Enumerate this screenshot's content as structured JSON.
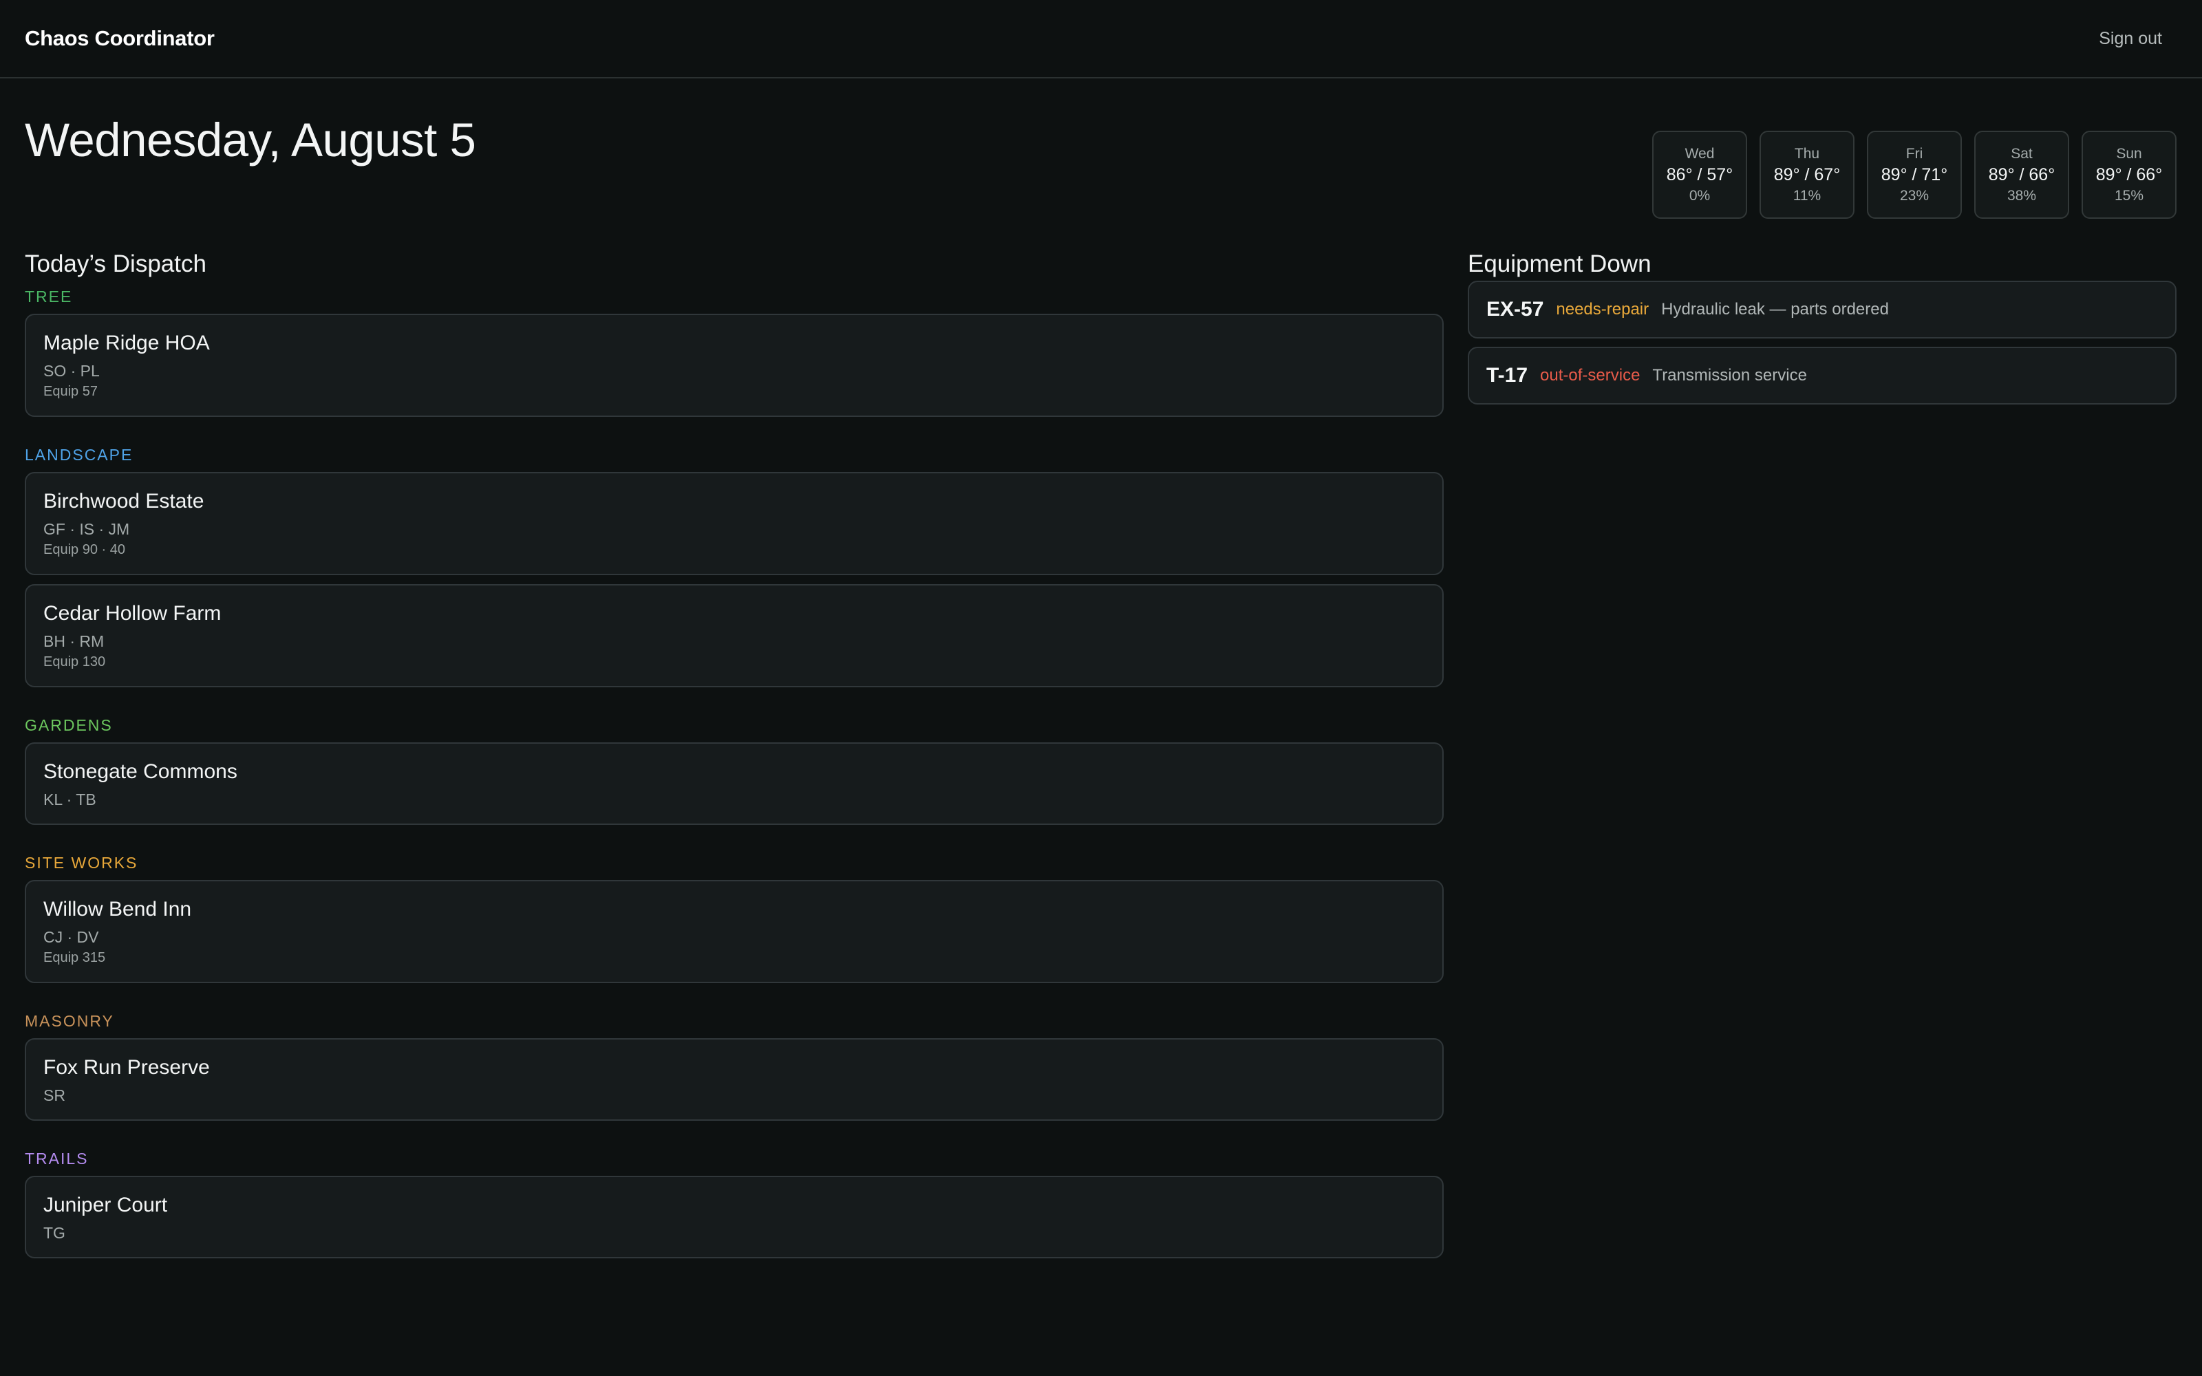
{
  "app": {
    "title": "Chaos Coordinator",
    "signout_label": "Sign out"
  },
  "page": {
    "date_title": "Wednesday, August 5"
  },
  "forecast": [
    {
      "day": "Wed",
      "temp": "86° / 57°",
      "rain": "0%"
    },
    {
      "day": "Thu",
      "temp": "89° / 67°",
      "rain": "11%"
    },
    {
      "day": "Fri",
      "temp": "89° / 71°",
      "rain": "23%"
    },
    {
      "day": "Sat",
      "temp": "89° / 66°",
      "rain": "38%"
    },
    {
      "day": "Sun",
      "temp": "89° / 66°",
      "rain": "15%"
    }
  ],
  "dispatch": {
    "title": "Today’s Dispatch",
    "groups": [
      {
        "label": "Tree",
        "color": "#4bb865",
        "jobs": [
          {
            "name": "Maple Ridge HOA",
            "crew": "SO · PL",
            "equip": "Equip 57"
          }
        ]
      },
      {
        "label": "Landscape",
        "color": "#4fa3e8",
        "jobs": [
          {
            "name": "Birchwood Estate",
            "crew": "GF · IS · JM",
            "equip": "Equip 90 · 40"
          },
          {
            "name": "Cedar Hollow Farm",
            "crew": "BH · RM",
            "equip": "Equip 130"
          }
        ]
      },
      {
        "label": "Gardens",
        "color": "#6cc75e",
        "jobs": [
          {
            "name": "Stonegate Commons",
            "crew": "KL · TB"
          }
        ]
      },
      {
        "label": "Site Works",
        "color": "#e8a83a",
        "jobs": [
          {
            "name": "Willow Bend Inn",
            "crew": "CJ · DV",
            "equip": "Equip 315"
          }
        ]
      },
      {
        "label": "Masonry",
        "color": "#c8925a",
        "jobs": [
          {
            "name": "Fox Run Preserve",
            "crew": "SR"
          }
        ]
      },
      {
        "label": "Trails",
        "color": "#b48cf0",
        "jobs": [
          {
            "name": "Juniper Court",
            "crew": "TG"
          }
        ]
      }
    ]
  },
  "equipment": {
    "title": "Equipment Down",
    "items": [
      {
        "id": "EX-57",
        "status": "needs-repair",
        "status_color": "#e8a83a",
        "note": "Hydraulic leak — parts ordered"
      },
      {
        "id": "T-17",
        "status": "out-of-service",
        "status_color": "#e85b4a",
        "note": "Transmission service"
      }
    ]
  }
}
